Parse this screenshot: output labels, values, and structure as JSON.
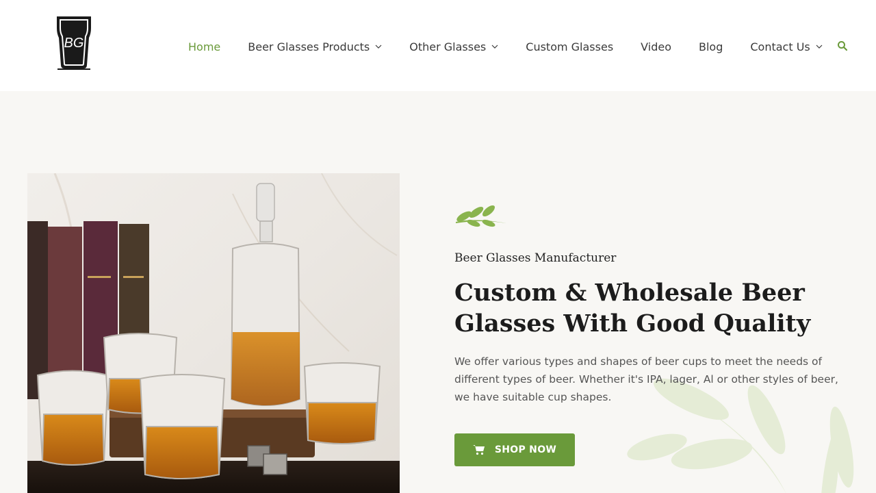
{
  "header": {
    "logo_text": "BG",
    "nav": [
      {
        "label": "Home",
        "active": true,
        "dropdown": false
      },
      {
        "label": "Beer Glasses Products",
        "active": false,
        "dropdown": true
      },
      {
        "label": "Other Glasses",
        "active": false,
        "dropdown": true
      },
      {
        "label": "Custom Glasses",
        "active": false,
        "dropdown": false
      },
      {
        "label": "Video",
        "active": false,
        "dropdown": false
      },
      {
        "label": "Blog",
        "active": false,
        "dropdown": false
      },
      {
        "label": "Contact Us",
        "active": false,
        "dropdown": true
      }
    ],
    "search_icon": "search-icon"
  },
  "hero": {
    "eyebrow": "Beer Glasses Manufacturer",
    "headline": "Custom & Wholesale Beer Glasses With Good Quality",
    "description": "We offer various types and shapes of beer cups to meet the needs of different types of beer. Whether it's IPA, lager, Al or other styles of beer, we have suitable cup shapes.",
    "cta_label": "SHOP NOW",
    "cta_icon": "cart-icon",
    "image_subject": "whiskey-decanter-glasses"
  },
  "colors": {
    "accent": "#6a9a3a",
    "hero_bg": "#f8f7f4",
    "text_dark": "#1c1c1c"
  }
}
